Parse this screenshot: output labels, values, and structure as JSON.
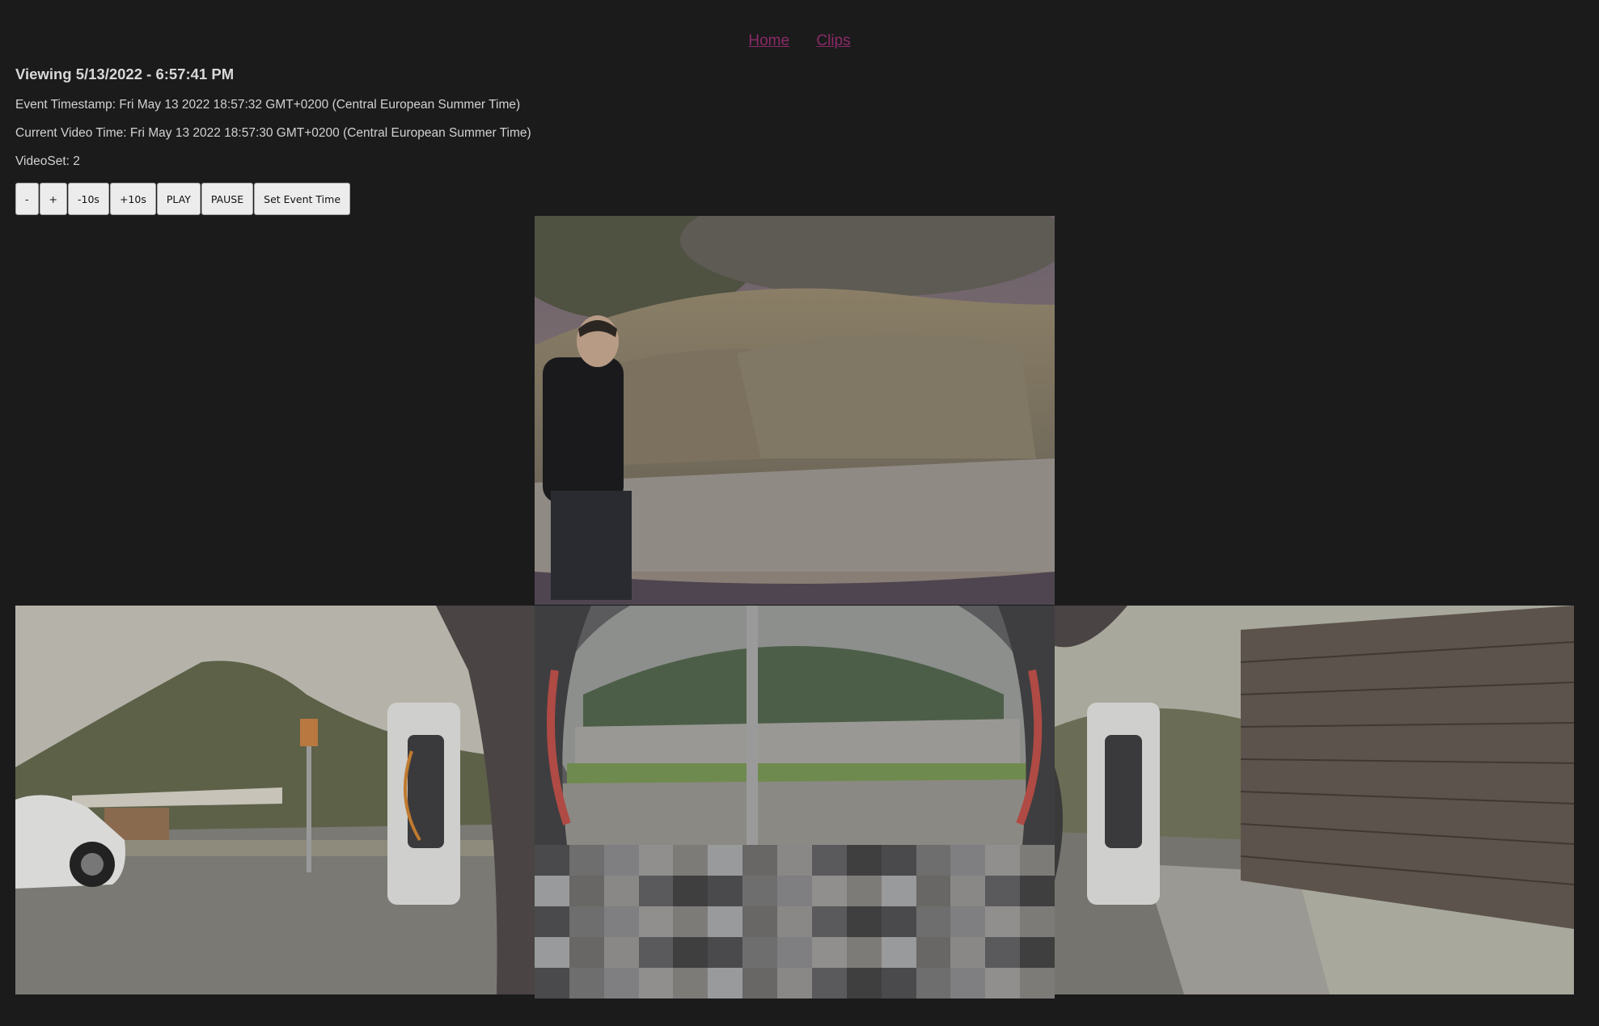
{
  "nav": {
    "home": "Home",
    "clips": "Clips"
  },
  "header": {
    "title": "Viewing 5/13/2022 - 6:57:41 PM",
    "event_timestamp": "Event Timestamp: Fri May 13 2022 18:57:32 GMT+0200 (Central European Summer Time)",
    "current_video_time": "Current Video Time: Fri May 13 2022 18:57:30 GMT+0200 (Central European Summer Time)",
    "videoset": "VideoSet: 2"
  },
  "controls": {
    "minus": "-",
    "plus": "+",
    "back10": "-10s",
    "fwd10": "+10s",
    "play": "PLAY",
    "pause": "PAUSE",
    "set_event_time": "Set Event Time"
  },
  "cameras": [
    "front-camera",
    "left-repeater-camera",
    "back-camera",
    "right-repeater-camera"
  ]
}
